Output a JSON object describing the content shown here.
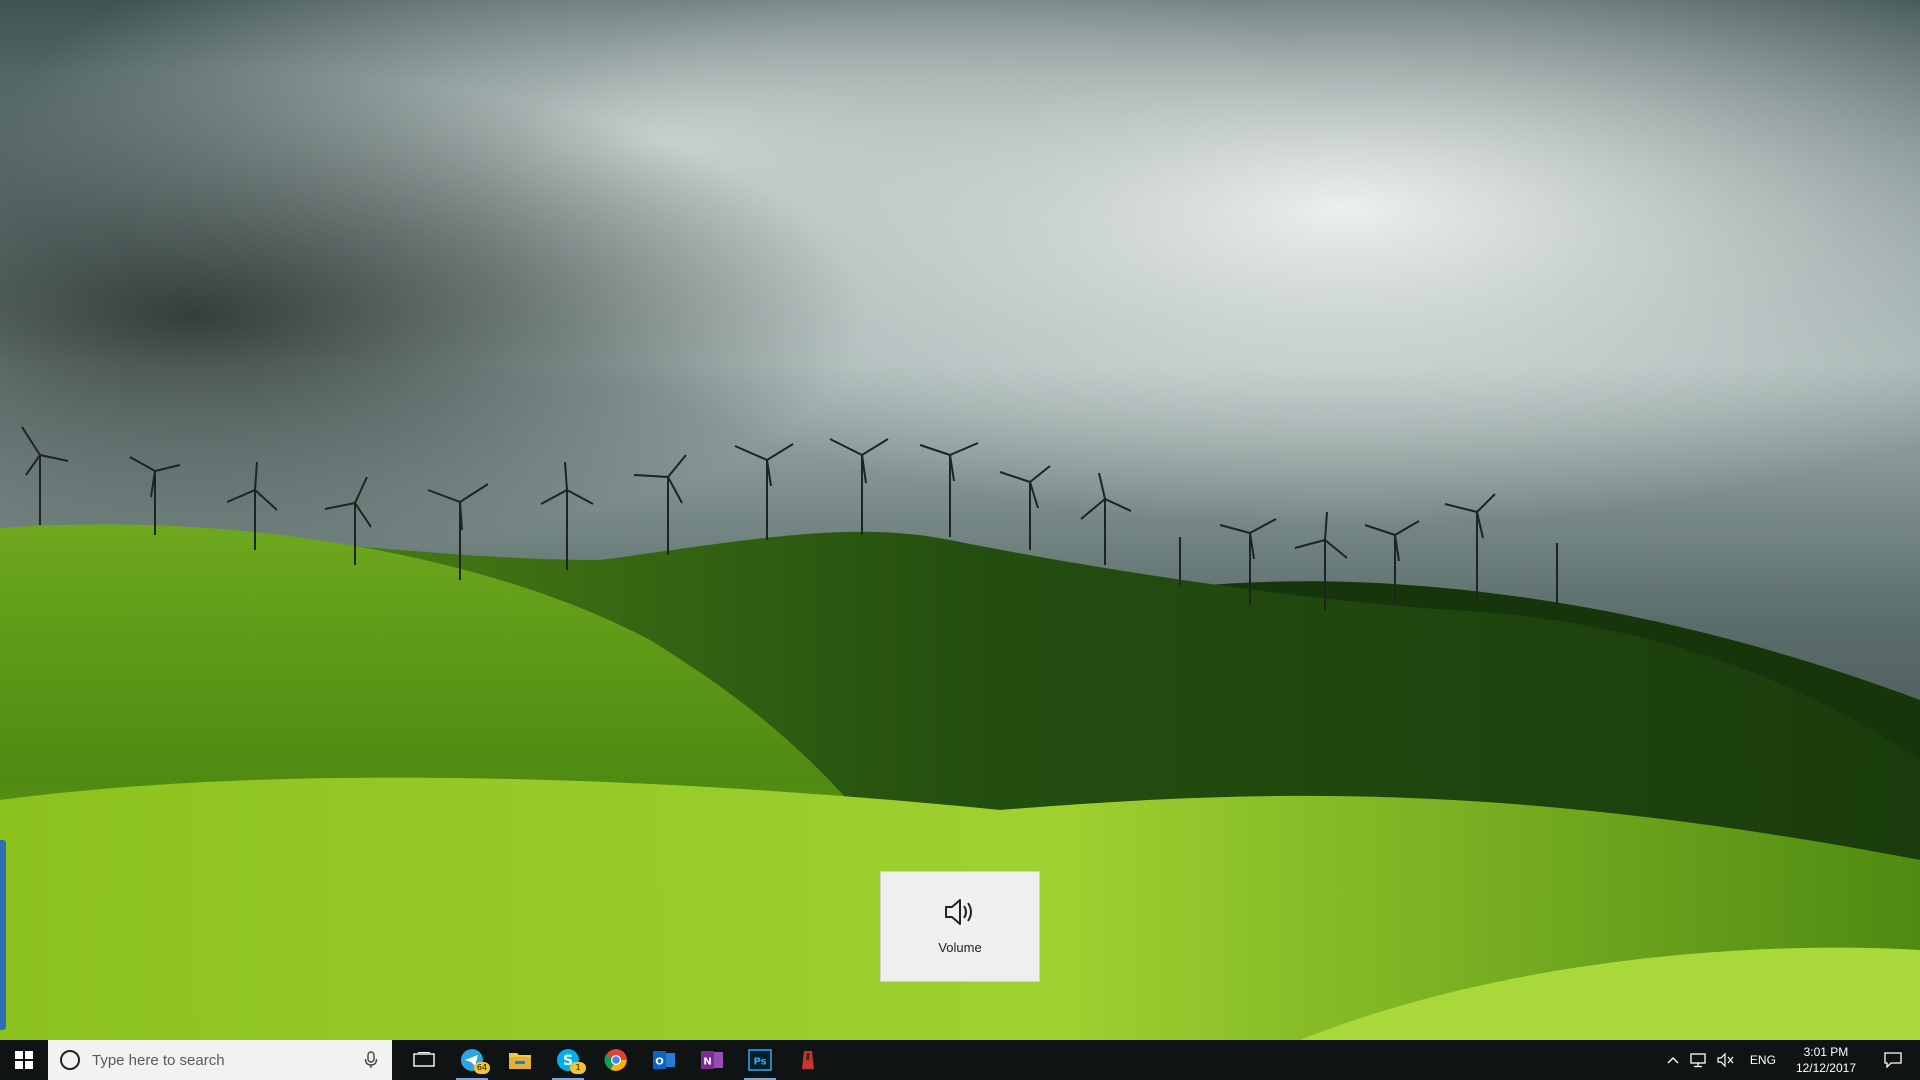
{
  "desktop": {
    "wallpaper": "green rolling hills with wind turbines under cloudy sky",
    "colors": {
      "sky_light": "#dfe6e4",
      "sky_dark": "#2e3d3c",
      "grass_bright": "#8cc21e",
      "grass_dark": "#1f4a10"
    }
  },
  "osd": {
    "label": "Volume",
    "icon": "speaker-icon"
  },
  "taskbar": {
    "search_placeholder": "Type here to search",
    "pinned": [
      {
        "name": "telegram",
        "icon": "telegram-icon",
        "badge": "64",
        "color": "#2ca5e0"
      },
      {
        "name": "file-explorer",
        "icon": "folder-icon",
        "color": "#f2c94c"
      },
      {
        "name": "skype",
        "icon": "skype-icon",
        "badge": "1",
        "color": "#00aff0"
      },
      {
        "name": "chrome",
        "icon": "chrome-icon"
      },
      {
        "name": "outlook",
        "icon": "outlook-icon",
        "color": "#0a64c8"
      },
      {
        "name": "onenote",
        "icon": "onenote-icon",
        "color": "#7b2c92"
      },
      {
        "name": "photoshop",
        "icon": "photoshop-icon",
        "label": "Ps",
        "color": "#31a8ff"
      },
      {
        "name": "app",
        "icon": "red-app-icon",
        "color": "#c0392b"
      }
    ],
    "tray": {
      "language": "ENG",
      "time": "3:01 PM",
      "date": "12/12/2017"
    }
  }
}
